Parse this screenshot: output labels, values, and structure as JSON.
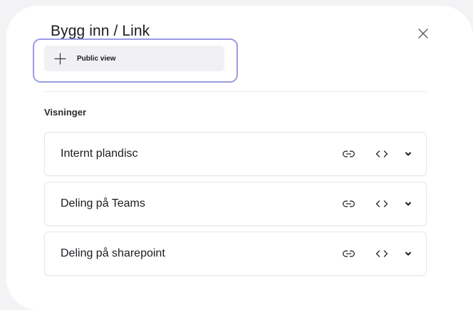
{
  "modal": {
    "title": "Bygg inn / Link",
    "close_icon": "close-icon",
    "public_view_button": {
      "label": "Public view",
      "icon": "plus-icon"
    },
    "section_label": "Visninger",
    "views": [
      {
        "name": "Internt plandisc"
      },
      {
        "name": "Deling på Teams"
      },
      {
        "name": "Deling på sharepoint"
      }
    ],
    "row_action_icons": [
      "link-icon",
      "embed-code-icon",
      "chevron-down-icon"
    ]
  },
  "colors": {
    "page_background": "#f3f3f5",
    "modal_background": "#ffffff",
    "focus_ring": "#9b9ae6",
    "button_background": "#f1f1f5",
    "text": "#1c1c22",
    "border": "#e6e6ec"
  }
}
